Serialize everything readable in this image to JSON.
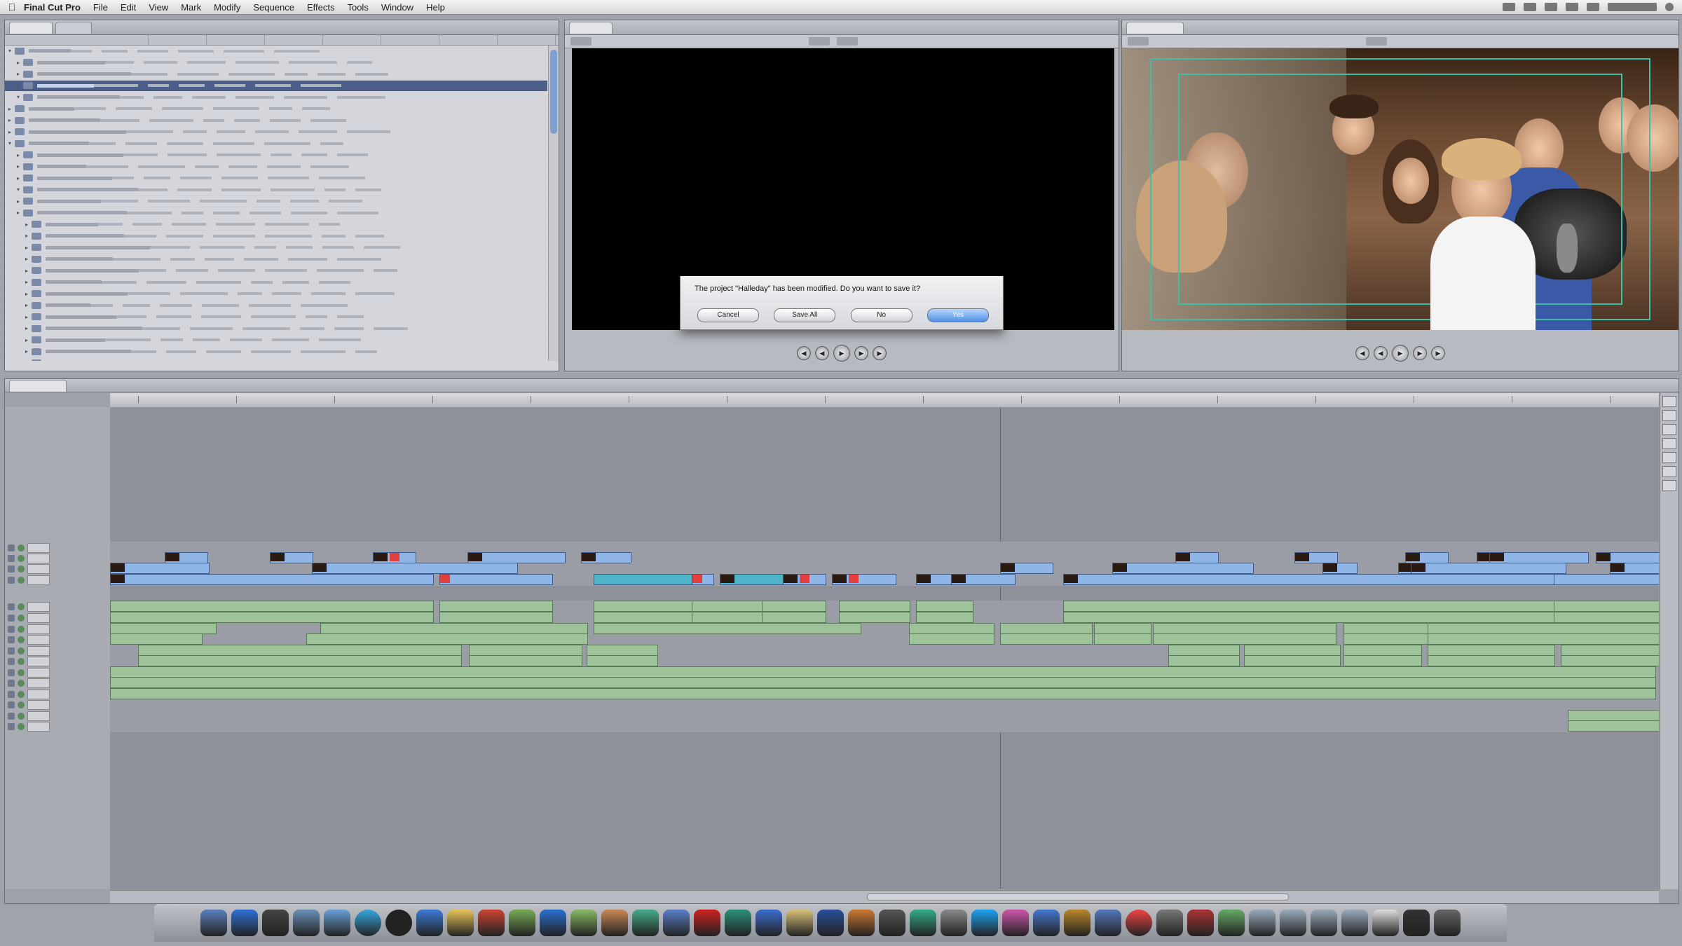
{
  "menubar": {
    "app_name": "Final Cut Pro",
    "items": [
      "File",
      "Edit",
      "View",
      "Mark",
      "Modify",
      "Sequence",
      "Effects",
      "Tools",
      "Window",
      "Help"
    ]
  },
  "dialog": {
    "message": "The project \"Halleday\" has been modified. Do you want to save it?",
    "buttons": [
      "Cancel",
      "Save All",
      "No",
      "Yes"
    ]
  },
  "colors": {
    "video_clip": "#8fb6e6",
    "audio_clip": "#9ec29a",
    "selected_row": "#4b5f8a",
    "default_button": "#4f8fe4",
    "safe_frame": "#3fbfa8"
  },
  "icons": {
    "apple": "apple-icon",
    "play": "play-icon",
    "dock": "app-icon"
  }
}
